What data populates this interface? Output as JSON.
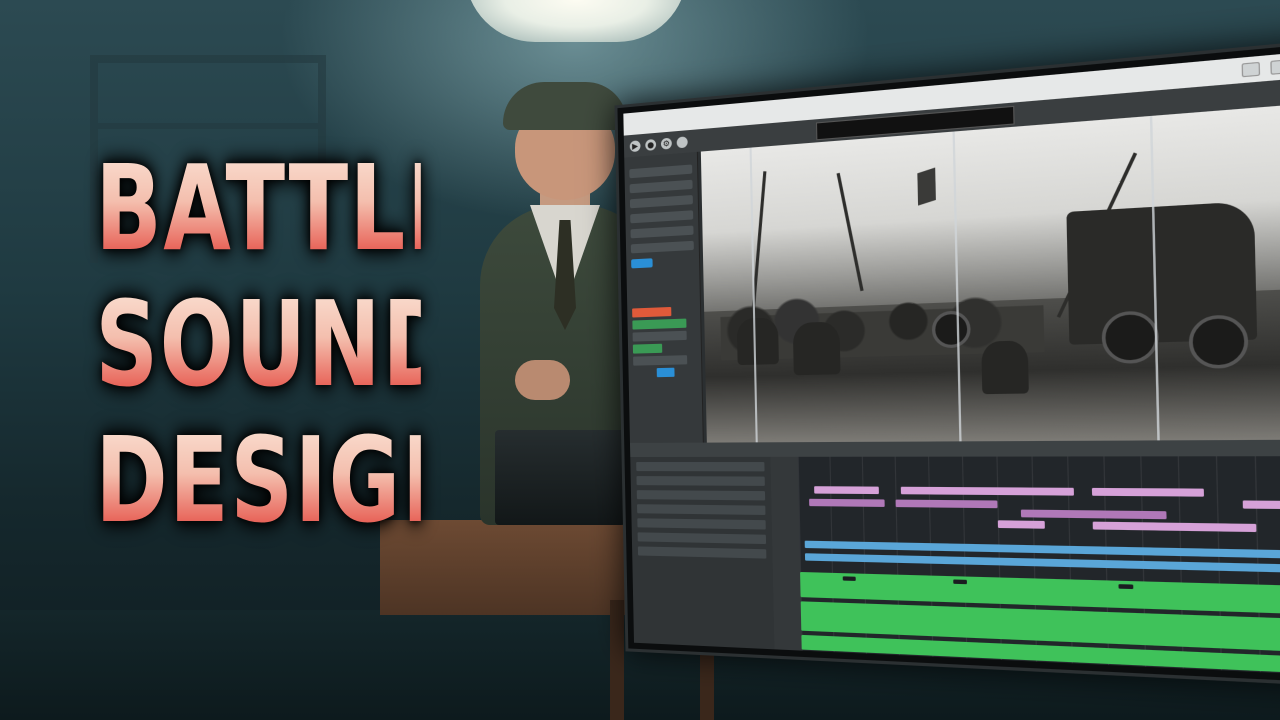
{
  "title": {
    "lines": [
      "BATTLE",
      "SOUND",
      "DESIGN"
    ]
  },
  "daw": {
    "window_title": "",
    "transport": {
      "left_label": "",
      "right_label": ""
    }
  },
  "colors": {
    "title_top": "#fbe6d9",
    "title_bottom": "#d8483f",
    "clip_purple": "#b078b8",
    "clip_blue": "#5aa6d8",
    "clip_green": "#3fc25a",
    "close_button": "#e2553f"
  },
  "icons": [
    "minimize-icon",
    "maximize-icon",
    "close-icon",
    "play-icon",
    "record-icon",
    "settings-icon"
  ]
}
